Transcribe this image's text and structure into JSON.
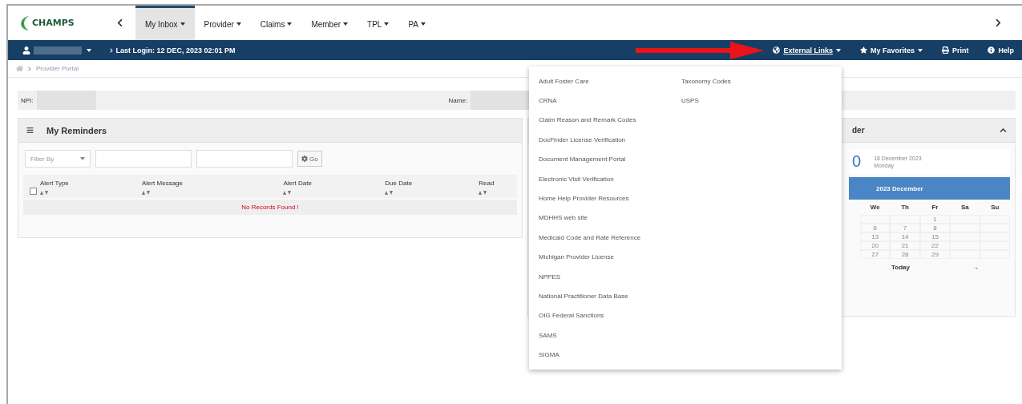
{
  "nav": {
    "logo": "CHAMPS",
    "items": [
      {
        "label": "My Inbox",
        "selected": true
      },
      {
        "label": "Provider",
        "selected": false
      },
      {
        "label": "Claims",
        "selected": false
      },
      {
        "label": "Member",
        "selected": false
      },
      {
        "label": "TPL",
        "selected": false
      },
      {
        "label": "PA",
        "selected": false
      }
    ]
  },
  "user_bar": {
    "last_login": "Last Login: 12 DEC, 2023 02:01 PM",
    "links": [
      {
        "label": "External Links",
        "kind": "globe",
        "dropdown": true,
        "open": true
      },
      {
        "label": "My Favorites",
        "kind": "star",
        "dropdown": true,
        "open": false
      },
      {
        "label": "Print",
        "kind": "print",
        "dropdown": false,
        "open": false
      },
      {
        "label": "Help",
        "kind": "help",
        "dropdown": false,
        "open": false
      }
    ]
  },
  "breadcrumb": [
    "Provider Portal"
  ],
  "provider": {
    "npi_label": "NPI:",
    "name_label": "Name:"
  },
  "reminders": {
    "title": "My Reminders",
    "filter_placeholder": "Filter By",
    "go": "Go",
    "select_all": {
      "checked": false
    },
    "columns": [
      "Alert Type",
      "Alert Message",
      "Alert Date",
      "Due Date",
      "Read"
    ],
    "empty_message": "No Records Found !"
  },
  "calendar": {
    "title": "der",
    "day_number": "0",
    "date_text": "18 December 2023",
    "weekday": "Monday",
    "month_label": "2023 December",
    "weekdays": [
      "We",
      "Th",
      "Fr",
      "Sa",
      "Su"
    ],
    "weeks": [
      {
        "fr": "1"
      },
      {
        "we": "6",
        "th": "7",
        "fr": "8"
      },
      {
        "we": "13",
        "th": "14",
        "fr": "15"
      },
      {
        "we": "20",
        "th": "21",
        "fr": "22"
      },
      {
        "we": "27",
        "th": "28",
        "fr": "29"
      }
    ],
    "today": "Today",
    "next": "→"
  },
  "external_links_menu": {
    "columns": [
      [
        "Adult Foster Care",
        "CRNA",
        "Claim Reason and Remark Codes",
        "DocFinder License Verification",
        "Document Management Portal",
        "Electronic Visit Verification",
        "Home Help Provider Resources",
        "MDHHS web site",
        "Medicaid Code and Rate Reference",
        "Michigan Provider License",
        "NPPES",
        "National Practitioner Data Base",
        "OIG Federal Sanctions",
        "SAMS",
        "SIGMA"
      ],
      [
        "Taxonomy Codes",
        "USPS"
      ]
    ]
  }
}
